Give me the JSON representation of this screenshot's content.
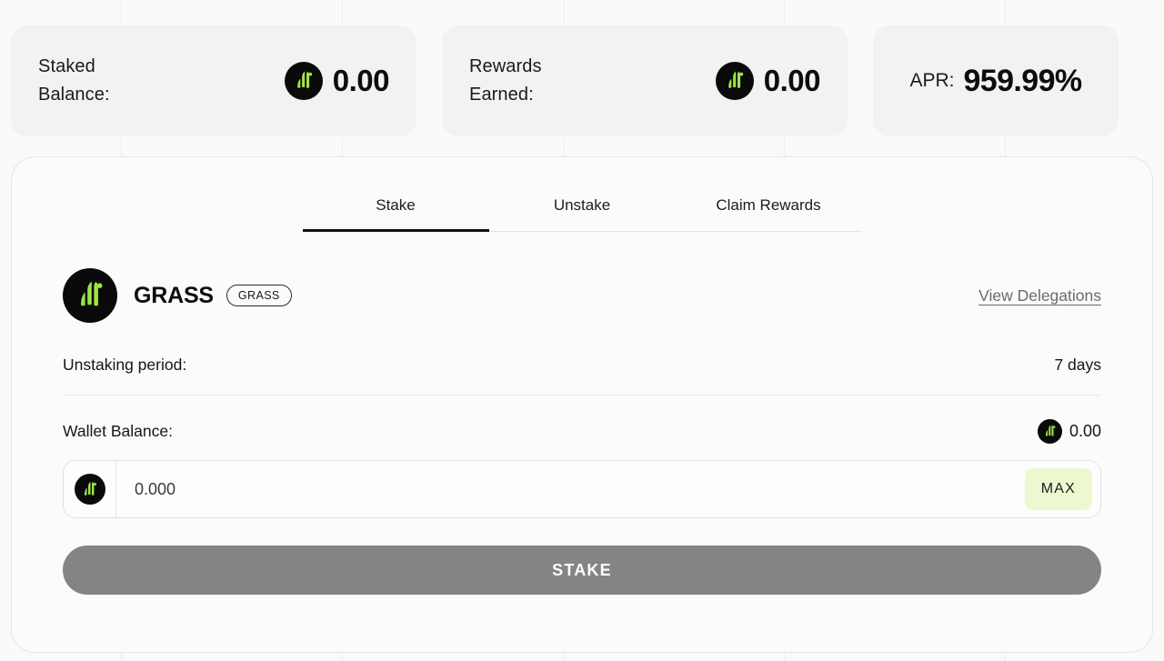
{
  "stats": [
    {
      "label": "Staked\nBalance:",
      "value": "0.00",
      "icon": "grass-token-icon"
    },
    {
      "label": "Rewards\nEarned:",
      "value": "0.00",
      "icon": "grass-token-icon"
    }
  ],
  "apr": {
    "label": "APR:",
    "value": "959.99%"
  },
  "tabs": [
    {
      "label": "Stake",
      "active": true
    },
    {
      "label": "Unstake",
      "active": false
    },
    {
      "label": "Claim Rewards",
      "active": false
    }
  ],
  "token": {
    "name": "GRASS",
    "badge": "GRASS",
    "icon": "grass-token-icon",
    "delegations_link": "View Delegations"
  },
  "details": {
    "unstaking_period_label": "Unstaking period:",
    "unstaking_period_value": "7 days",
    "wallet_balance_label": "Wallet Balance:",
    "wallet_balance_value": "0.00"
  },
  "amount_input": {
    "value": "",
    "placeholder": "0.000",
    "max_label": "MAX"
  },
  "action": {
    "stake_label": "STAKE"
  },
  "colors": {
    "page_bg": "#fafafa",
    "card_bg": "#f2f2f2",
    "panel_bg": "#fbfbfb",
    "accent_green": "#9ee544",
    "token_dark": "#0a0a0a",
    "max_btn_bg": "#eef8d0",
    "stake_btn_bg": "#848484",
    "grid_line": "#ededed"
  },
  "grid_lines_x": [
    133,
    376,
    620,
    862,
    1105
  ]
}
